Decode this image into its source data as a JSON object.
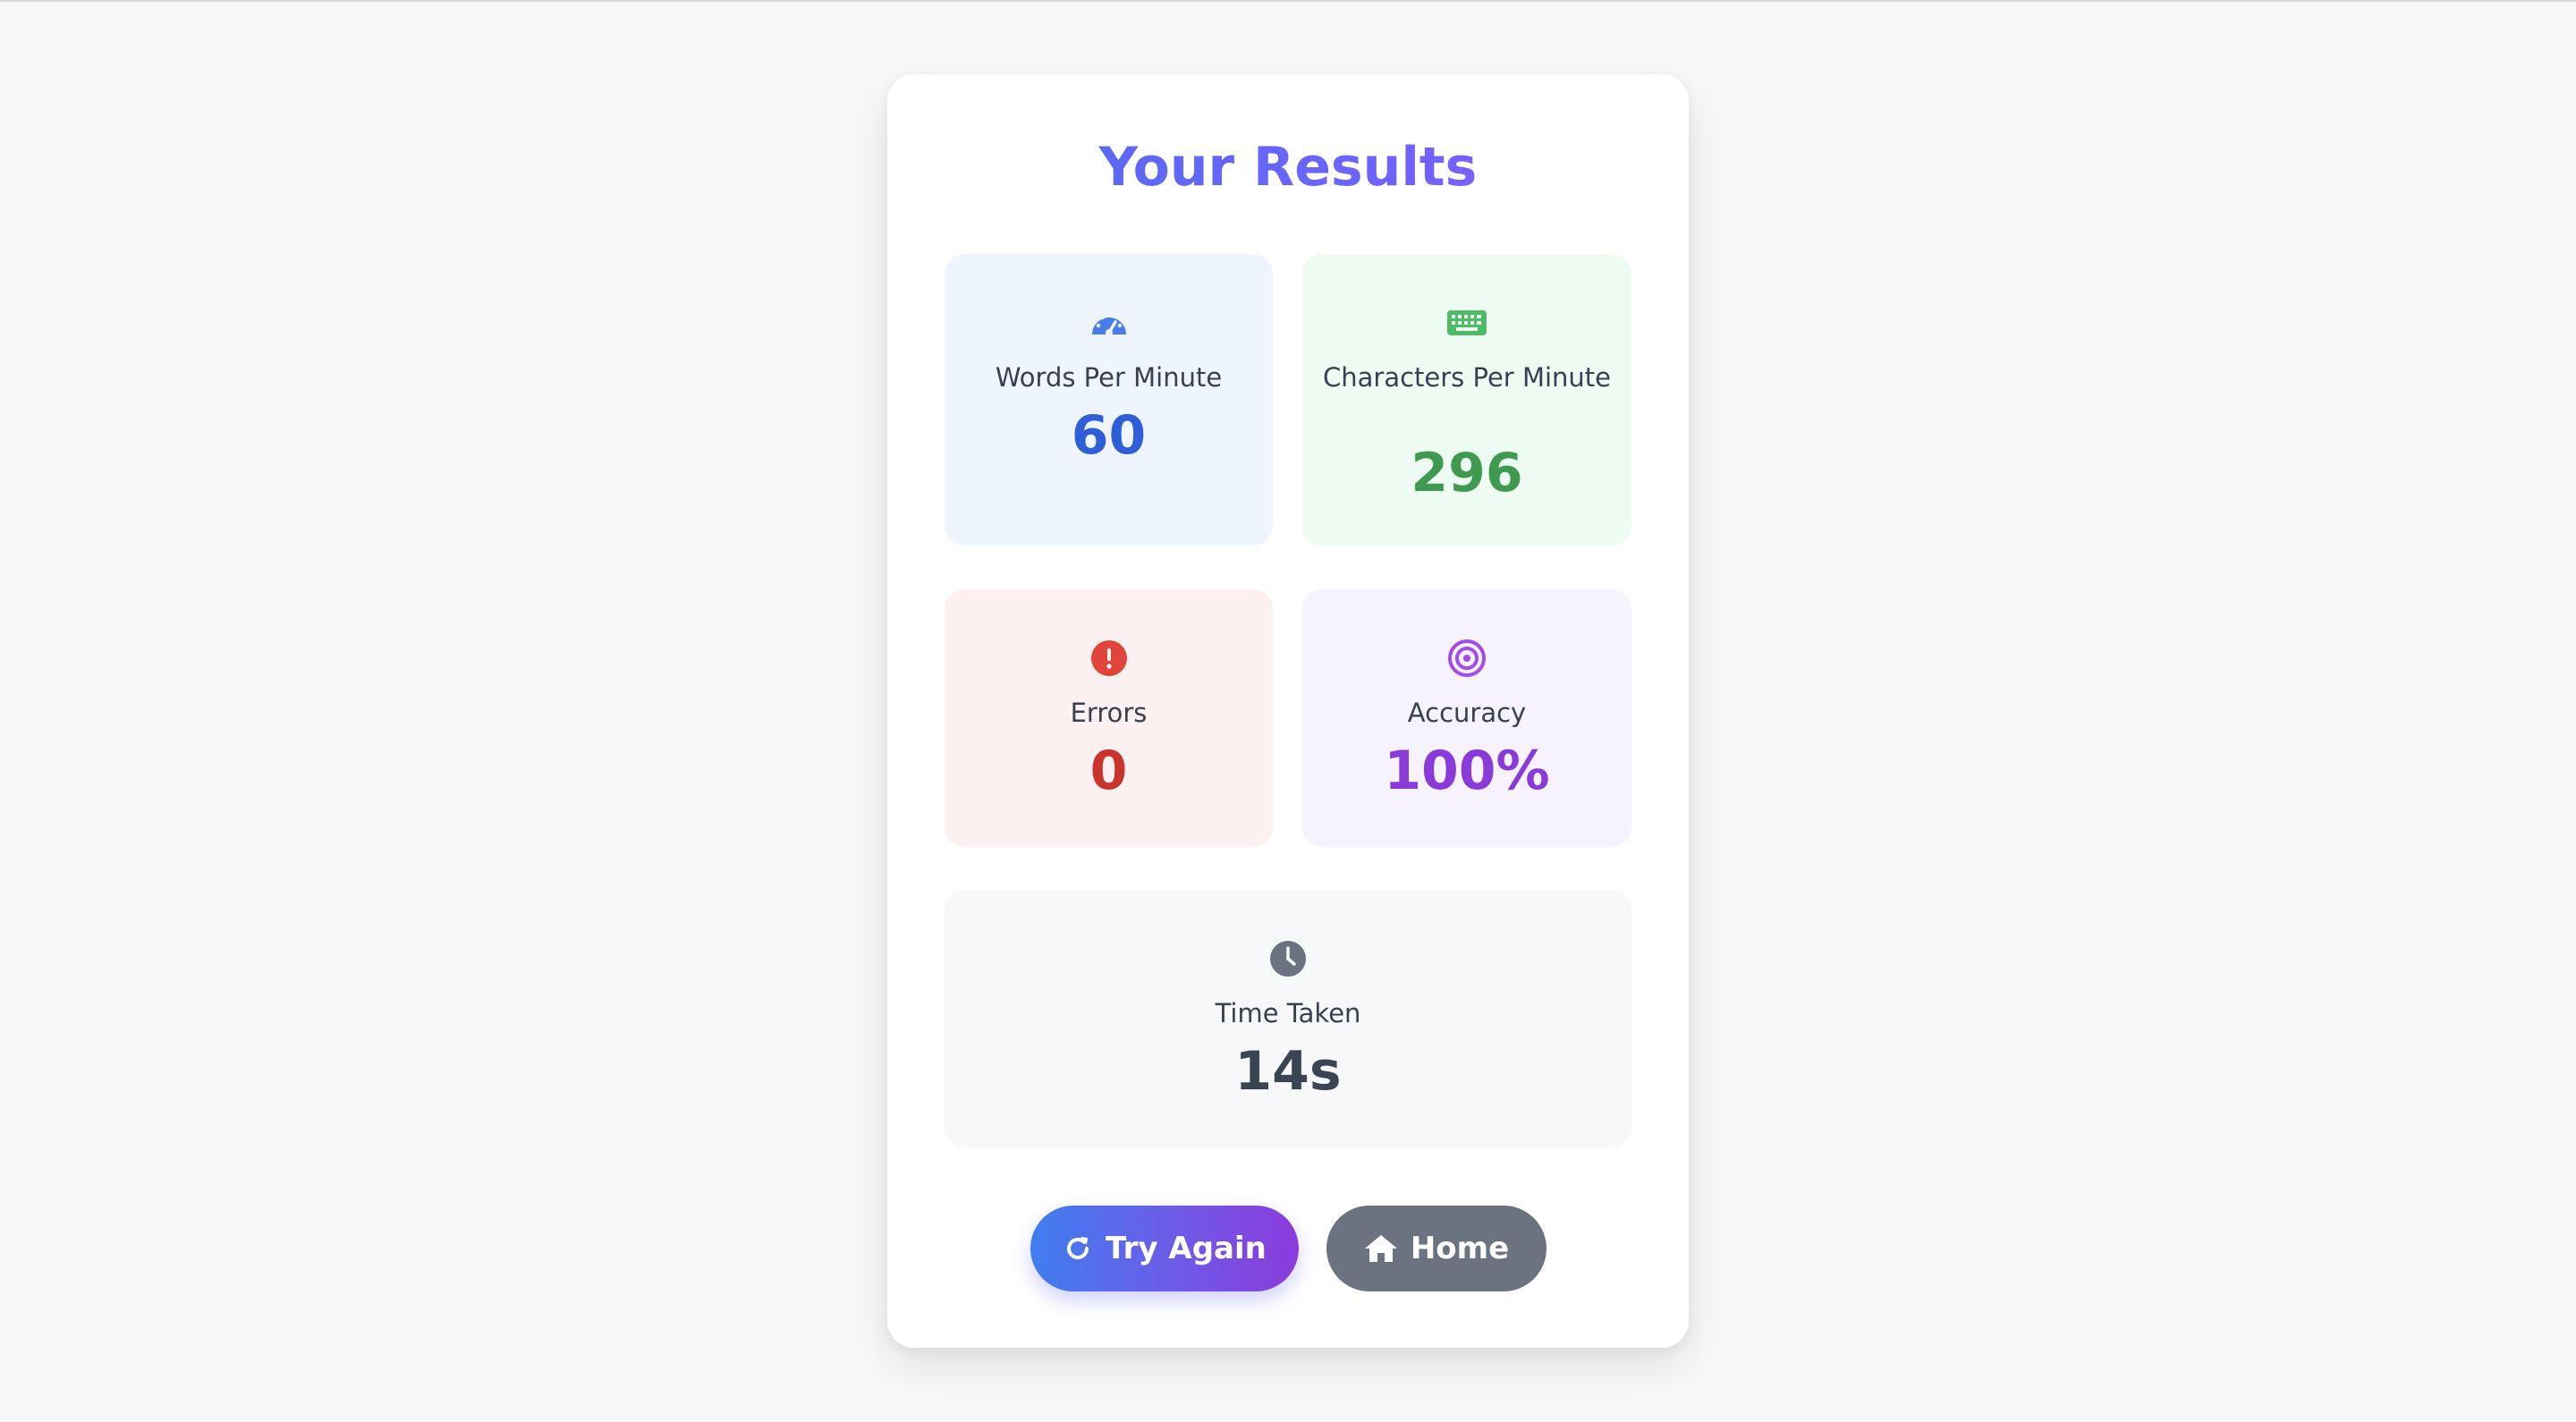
{
  "title": "Your Results",
  "stats": {
    "wpm": {
      "label": "Words Per Minute",
      "value": "60",
      "icon": "gauge-icon",
      "color": "#2f5fd8"
    },
    "cpm": {
      "label": "Characters Per Minute",
      "value": "296",
      "icon": "keyboard-icon",
      "color": "#3f9a4f"
    },
    "errors": {
      "label": "Errors",
      "value": "0",
      "icon": "exclamation-circle-icon",
      "color": "#c9352d"
    },
    "accuracy": {
      "label": "Accuracy",
      "value": "100%",
      "icon": "target-icon",
      "color": "#8a3ad8"
    },
    "time": {
      "label": "Time Taken",
      "value": "14s",
      "icon": "clock-icon",
      "color": "#3b4452"
    }
  },
  "buttons": {
    "try_again": {
      "label": "Try Again",
      "icon": "redo-icon"
    },
    "home": {
      "label": "Home",
      "icon": "home-icon"
    }
  },
  "colors": {
    "title_gradient_start": "#4f6ee8",
    "title_gradient_end": "#8b5cf6",
    "home_button": "#6b7280"
  }
}
